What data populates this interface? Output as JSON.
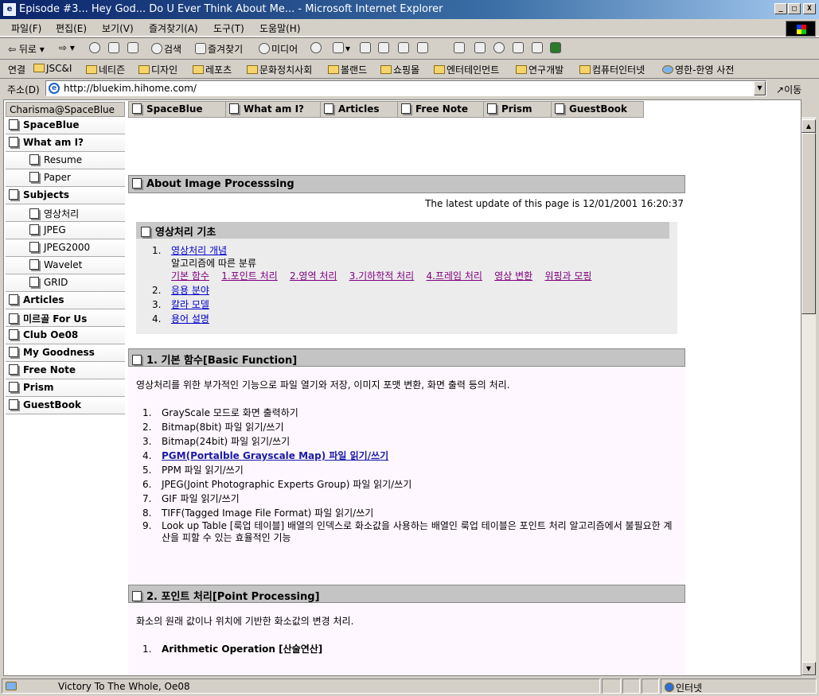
{
  "window": {
    "title": "Episode #3... Hey God... Do U Ever Think About Me... - Microsoft Internet Explorer",
    "icon_letter": "e",
    "minimize": "_",
    "maximize": "□",
    "close": "X"
  },
  "menu": [
    "파일(F)",
    "편집(E)",
    "보기(V)",
    "즐겨찾기(A)",
    "도구(T)",
    "도움말(H)"
  ],
  "toolbar": {
    "back": "뒤로",
    "search": "검색",
    "favorites": "즐겨찾기",
    "media": "미디어"
  },
  "links_bar": {
    "label": "연결",
    "items": [
      "JSC&I",
      "네티즌",
      "디자인",
      "레포츠",
      "문화정치사회",
      "볼랜드",
      "쇼핑몰",
      "엔터테인먼트",
      "연구개발",
      "컴퓨터인터넷",
      "영한-한영 사전"
    ]
  },
  "address": {
    "label": "주소(D)",
    "url": "http://bluekim.hihome.com/",
    "go": "이동"
  },
  "left_nav": {
    "header": "Charisma@SpaceBlue",
    "items": [
      {
        "label": "SpaceBlue",
        "sub": false
      },
      {
        "label": "What am I?",
        "sub": false
      },
      {
        "label": "Resume",
        "sub": true
      },
      {
        "label": "Paper",
        "sub": true
      },
      {
        "label": "Subjects",
        "sub": false
      },
      {
        "label": "영상처리",
        "sub": true
      },
      {
        "label": "JPEG",
        "sub": true
      },
      {
        "label": "JPEG2000",
        "sub": true
      },
      {
        "label": "Wavelet",
        "sub": true
      },
      {
        "label": "GRID",
        "sub": true
      },
      {
        "label": "Articles",
        "sub": false
      },
      {
        "label": "미르골 For Us",
        "sub": false
      },
      {
        "label": "Club Oe08",
        "sub": false
      },
      {
        "label": "My Goodness",
        "sub": false
      },
      {
        "label": "Free Note",
        "sub": false
      },
      {
        "label": "Prism",
        "sub": false
      },
      {
        "label": "GuestBook",
        "sub": false
      }
    ]
  },
  "top_nav": [
    "SpaceBlue",
    "What am I?",
    "Articles",
    "Free Note",
    "Prism",
    "GuestBook"
  ],
  "page": {
    "title": "About Image Processsing",
    "latest_update": "The latest update of this page is 12/01/2001 16:20:37",
    "basics": {
      "heading": "영상처리 기초",
      "items": [
        {
          "num": "1.",
          "label": "영상처리 개념"
        },
        {
          "num": "2.",
          "label": "응용 분야"
        },
        {
          "num": "3.",
          "label": "칼라 모델"
        },
        {
          "num": "4.",
          "label": "용어 설명"
        }
      ],
      "algo_caption": "알고리즘에 따른 분류",
      "algo_links": [
        "기본 함수",
        "1.포인트 처리",
        "2.영역 처리",
        "3.기하학적 처리",
        "4.프레임 처리",
        "영상 변환",
        "워핑과 모핑"
      ]
    },
    "section1": {
      "heading": "1. 기본 함수[Basic Function]",
      "intro": "영상처리를 위한 부가적인 기능으로 파일 열기와 저장, 이미지 포맷 변환, 화면 출력 등의 처리.",
      "items": [
        {
          "num": "1.",
          "text": "GrayScale 모드로 화면 출력하기"
        },
        {
          "num": "2.",
          "text": "Bitmap(8bit) 파일 읽기/쓰기"
        },
        {
          "num": "3.",
          "text": "Bitmap(24bit) 파일 읽기/쓰기"
        },
        {
          "num": "4.",
          "text": "PGM(Portalble Grayscale Map) 파일 읽기/쓰기"
        },
        {
          "num": "5.",
          "text": "PPM 파일 읽기/쓰기"
        },
        {
          "num": "6.",
          "text": "JPEG(Joint Photographic Experts Group) 파일 읽기/쓰기"
        },
        {
          "num": "7.",
          "text": "GIF 파일 읽기/쓰기"
        },
        {
          "num": "8.",
          "text": "TIFF(Tagged Image File Format) 파일 읽기/쓰기"
        },
        {
          "num": "9.",
          "text": "Look up Table [룩업 테이블] 배열의 인덱스로 화소값을 사용하는 배열인 룩업 테이블은 포인트 처리 알고리즘에서 불필요한 계산을 피할 수 있는 효율적인 기능"
        }
      ]
    },
    "section2": {
      "heading": "2. 포인트 처리[Point Processing]",
      "intro": "화소의 원래 값이나 위치에 기반한 화소값의 변경 처리.",
      "first_item_num": "1.",
      "first_item": "Arithmetic Operation [산술연산]"
    }
  },
  "status": {
    "text": "Victory To The Whole, Oe08",
    "zone": "인터넷"
  }
}
